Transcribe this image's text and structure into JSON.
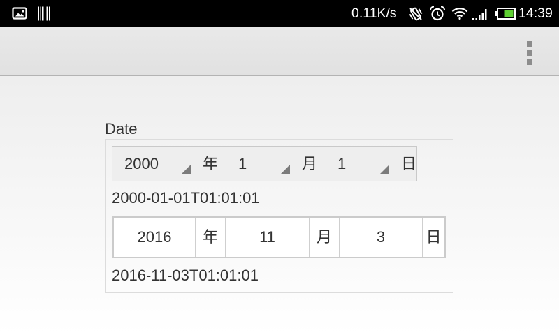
{
  "status_bar": {
    "network_speed": "0.11K/s",
    "time": "14:39",
    "battery_level": 0.6,
    "icons": {
      "notifications": [
        "image-icon",
        "barcode-icon"
      ],
      "system": [
        "vibrate-off-icon",
        "alarm-icon",
        "wifi-icon",
        "signal-icon",
        "battery-icon"
      ]
    }
  },
  "action_bar": {
    "menu_icon": "overflow-menu-icon"
  },
  "date_field": {
    "label": "Date",
    "spinner_picker": {
      "year": "2000",
      "year_unit": "年",
      "month": "1",
      "month_unit": "月",
      "day": "1",
      "day_unit": "日"
    },
    "spinner_result": "2000-01-01T01:01:01",
    "input_picker": {
      "year": "2016",
      "year_unit": "年",
      "month": "11",
      "month_unit": "月",
      "day": "3",
      "day_unit": "日"
    },
    "input_result": "2016-11-03T01:01:01"
  },
  "colors": {
    "status_bar_bg": "#000000",
    "battery_fill": "#5fd133",
    "spinner_arrow": "#7b7b7b",
    "text": "#333333"
  }
}
